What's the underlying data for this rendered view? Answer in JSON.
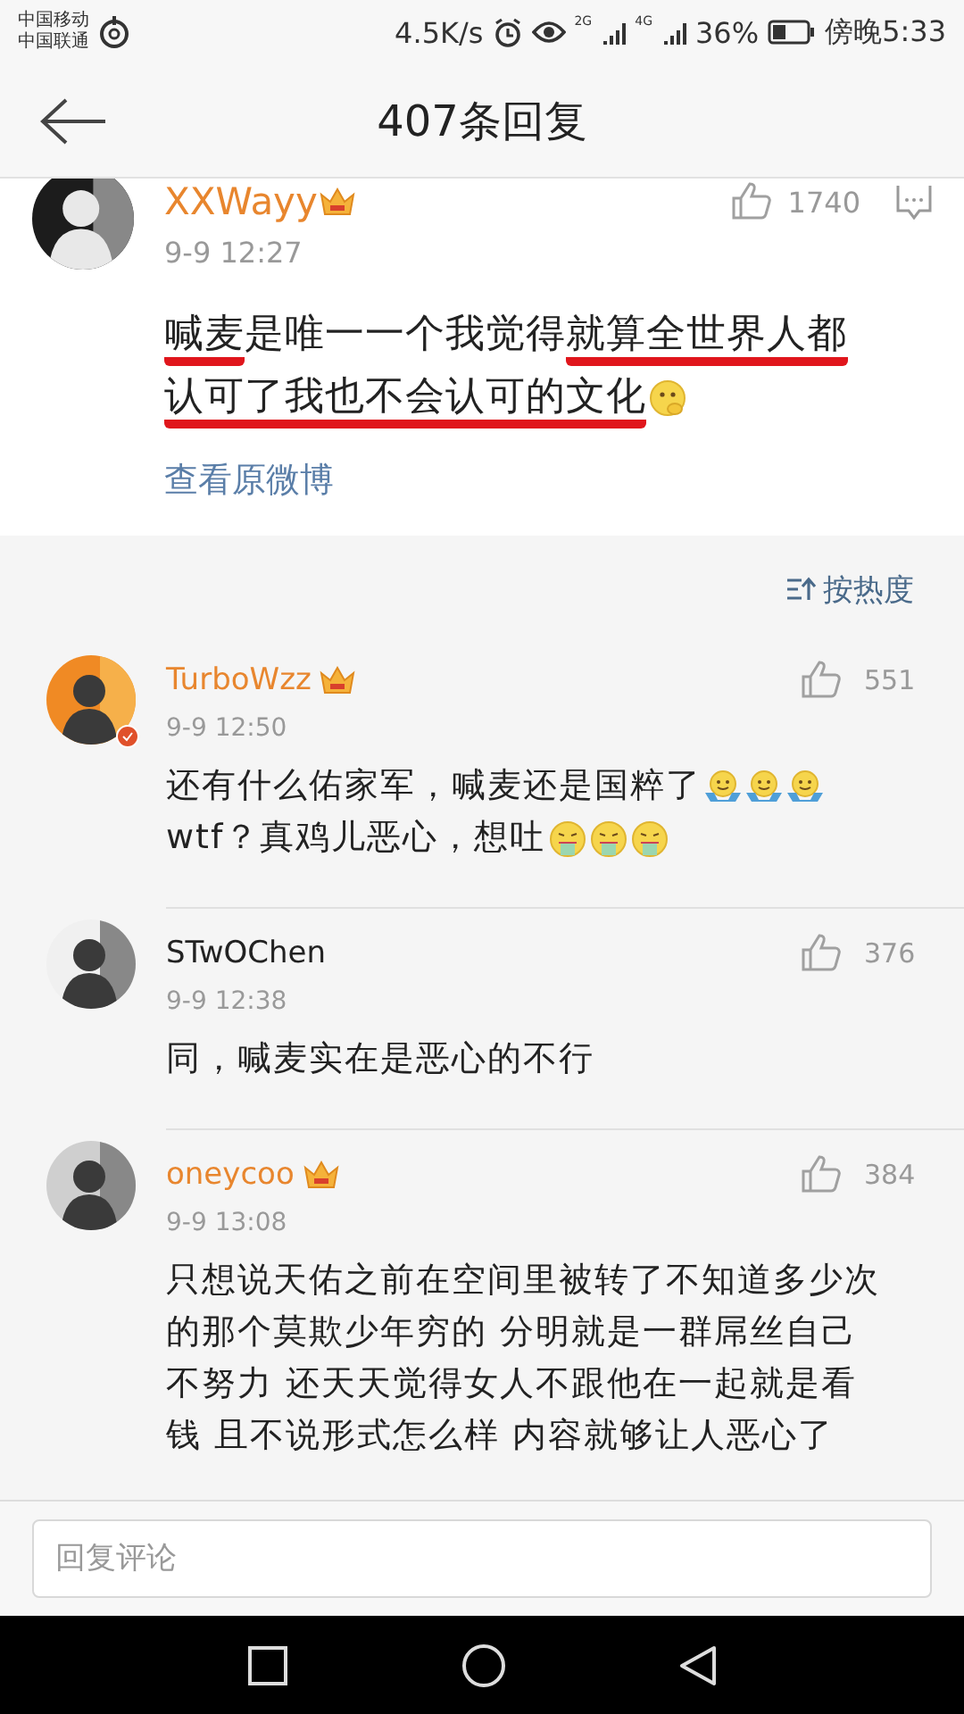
{
  "status_bar": {
    "carriers": [
      "中国移动",
      "中国联通"
    ],
    "speed": "4.5K/s",
    "network_labels": [
      "2G",
      "4G"
    ],
    "battery_text": "36%",
    "time": "傍晚5:33"
  },
  "header": {
    "title": "407条回复"
  },
  "post": {
    "author": "XXWayy",
    "vip": true,
    "time": "9-9 12:27",
    "likes": "1740",
    "lines": [
      {
        "segments": [
          {
            "text": "喊麦",
            "underlined": true
          },
          {
            "text": "是唯一一个我觉得",
            "underlined": false
          },
          {
            "text": "就算全世界人都",
            "underlined": true
          }
        ]
      },
      {
        "segments": [
          {
            "text": "认可了我也不会认可的文化",
            "underlined": true
          }
        ],
        "emoji": [
          {
            "kind": "thinking"
          }
        ]
      }
    ],
    "link": "查看原微博"
  },
  "sort": {
    "label": "按热度"
  },
  "comments": [
    {
      "author": "TurboWzz",
      "vip": true,
      "verified": true,
      "time": "9-9 12:50",
      "likes": "551",
      "lines": [
        {
          "text": "还有什么佑家军，喊麦还是国粹了",
          "emoji": [
            {
              "kind": "shrug"
            },
            {
              "kind": "shrug"
            },
            {
              "kind": "shrug"
            }
          ]
        },
        {
          "text": "wtf？真鸡儿恶心，想吐",
          "emoji": [
            {
              "kind": "vomit"
            },
            {
              "kind": "vomit"
            },
            {
              "kind": "vomit"
            }
          ]
        }
      ]
    },
    {
      "author": "STwOChen",
      "vip": false,
      "verified": false,
      "time": "9-9 12:38",
      "likes": "376",
      "lines": [
        {
          "text": "同，喊麦实在是恶心的不行"
        }
      ]
    },
    {
      "author": "oneycoo",
      "vip": true,
      "verified": false,
      "time": "9-9 13:08",
      "likes": "384",
      "lines": [
        {
          "text": "只想说天佑之前在空间里被转了不知道多少次"
        },
        {
          "text": "的那个莫欺少年穷的 分明就是一群屌丝自己"
        },
        {
          "text": "不努力 还天天觉得女人不跟他在一起就是看"
        },
        {
          "text": "钱 且不说形式怎么样 内容就够让人恶心了"
        }
      ]
    }
  ],
  "reply": {
    "placeholder": "回复评论"
  }
}
